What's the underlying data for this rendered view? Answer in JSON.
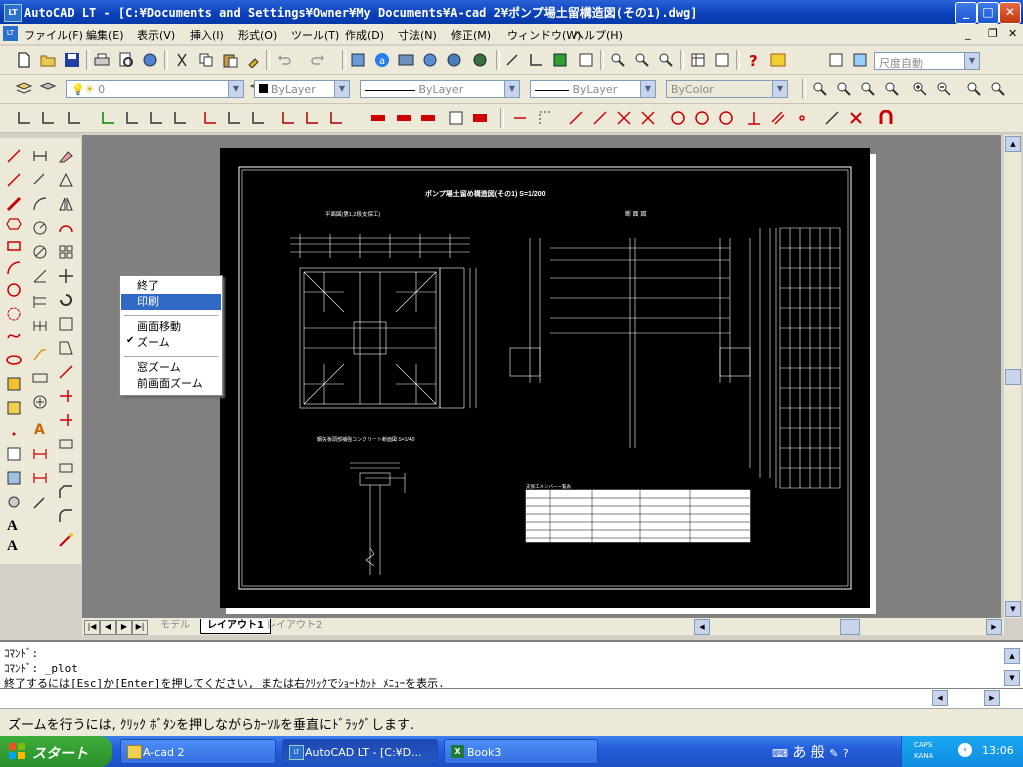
{
  "window": {
    "title": "AutoCAD LT - [C:¥Documents and Settings¥Owner¥My Documents¥A-cad 2¥ポンプ場土留構造図(その1).dwg]",
    "app_icon_text": "LT"
  },
  "menubar": {
    "items": [
      "ファイル(F)",
      "編集(E)",
      "表示(V)",
      "挿入(I)",
      "形式(O)",
      "ツール(T)",
      "作成(D)",
      "寸法(N)",
      "修正(M)",
      "ウィンドウ(W)",
      "ヘルプ(H)"
    ]
  },
  "toolbar": {
    "dimstyle_combo": "尺度自動",
    "layer_combo": "0",
    "color_combo": "ByLayer",
    "linetype_combo": "ByLayer",
    "lineweight_combo": "ByLayer",
    "plotstyle_combo": "ByColor"
  },
  "drawing": {
    "title": "ポンプ場土留め構造図(その1)  S=1/200",
    "plan_label": "平面図(第1,2段支保工)",
    "section_label": "断 面 図",
    "detail_label": "鋼矢板頭部補強コンクリート断面図 S=1/40",
    "table_title": "支保工メンバー一覧表"
  },
  "layout_tabs": {
    "tabs": [
      "モデル",
      "レイアウト1",
      "レイアウト2"
    ],
    "active": "レイアウト1"
  },
  "context_menu": {
    "items": [
      {
        "label": "終了",
        "checked": false,
        "highlighted": false
      },
      {
        "label": "印刷",
        "checked": false,
        "highlighted": true
      },
      {
        "label": "画面移動",
        "checked": false,
        "highlighted": false
      },
      {
        "label": "ズーム",
        "checked": true,
        "highlighted": false
      },
      {
        "label": "窓ズーム",
        "checked": false,
        "highlighted": false
      },
      {
        "label": "前画面ズーム",
        "checked": false,
        "highlighted": false
      }
    ]
  },
  "command": {
    "lines": [
      "ｺﾏﾝﾄﾞ:",
      "ｺﾏﾝﾄﾞ: _plot",
      "終了するには[Esc]か[Enter]を押してください, または右ｸﾘｯｸでｼｮｰﾄｶｯﾄ ﾒﾆｭｰを表示."
    ]
  },
  "statusbar": {
    "text": "ズームを行うには, ｸﾘｯｸ ﾎﾞﾀﾝを押しながらｶｰｿﾙを垂直にﾄﾞﾗｯｸﾞします."
  },
  "taskbar": {
    "start_label": "スタート",
    "buttons": [
      {
        "label": "A-cad 2",
        "active": false
      },
      {
        "label": "AutoCAD LT - [C:¥D...",
        "active": true
      },
      {
        "label": "Book3",
        "active": false
      }
    ],
    "tray_caps": "CAPS",
    "tray_kana": "KANA",
    "tray_ime": "あ 般",
    "clock": "13:06"
  },
  "colors": {
    "titlebar": "#0a3fb8",
    "canvas_bg": "#808080",
    "paper": "#000000",
    "highlight": "#316ac5"
  }
}
